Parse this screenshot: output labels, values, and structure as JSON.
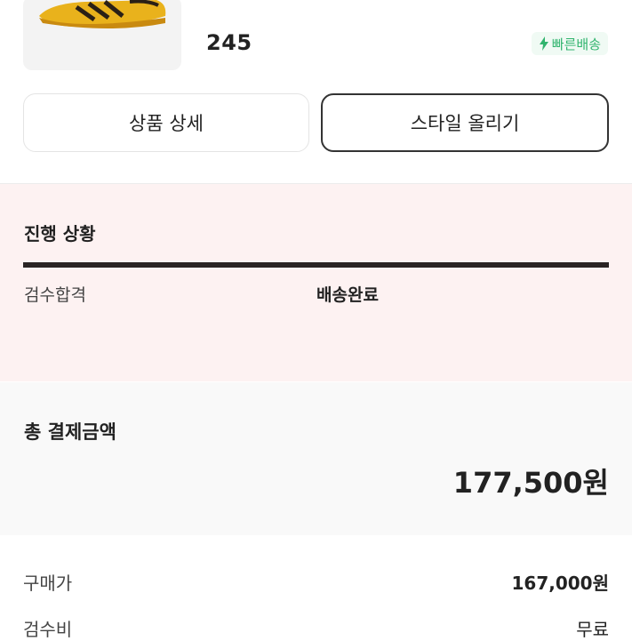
{
  "product": {
    "size": "245",
    "fast_delivery_label": "빠른배송"
  },
  "buttons": {
    "detail_label": "상품 상세",
    "style_label": "스타일 올리기"
  },
  "progress": {
    "title": "진행 상황",
    "steps": [
      "검수합격",
      "배송완료"
    ]
  },
  "payment": {
    "total_label": "총 결제금액",
    "total_value": "177,500원",
    "rows": [
      {
        "label": "구매가",
        "value": "167,000원"
      },
      {
        "label": "검수비",
        "value": "무료"
      }
    ]
  },
  "colors": {
    "accent_green": "#31b46e",
    "progress_bg": "#fdf2f2",
    "bar": "#2a2424"
  }
}
